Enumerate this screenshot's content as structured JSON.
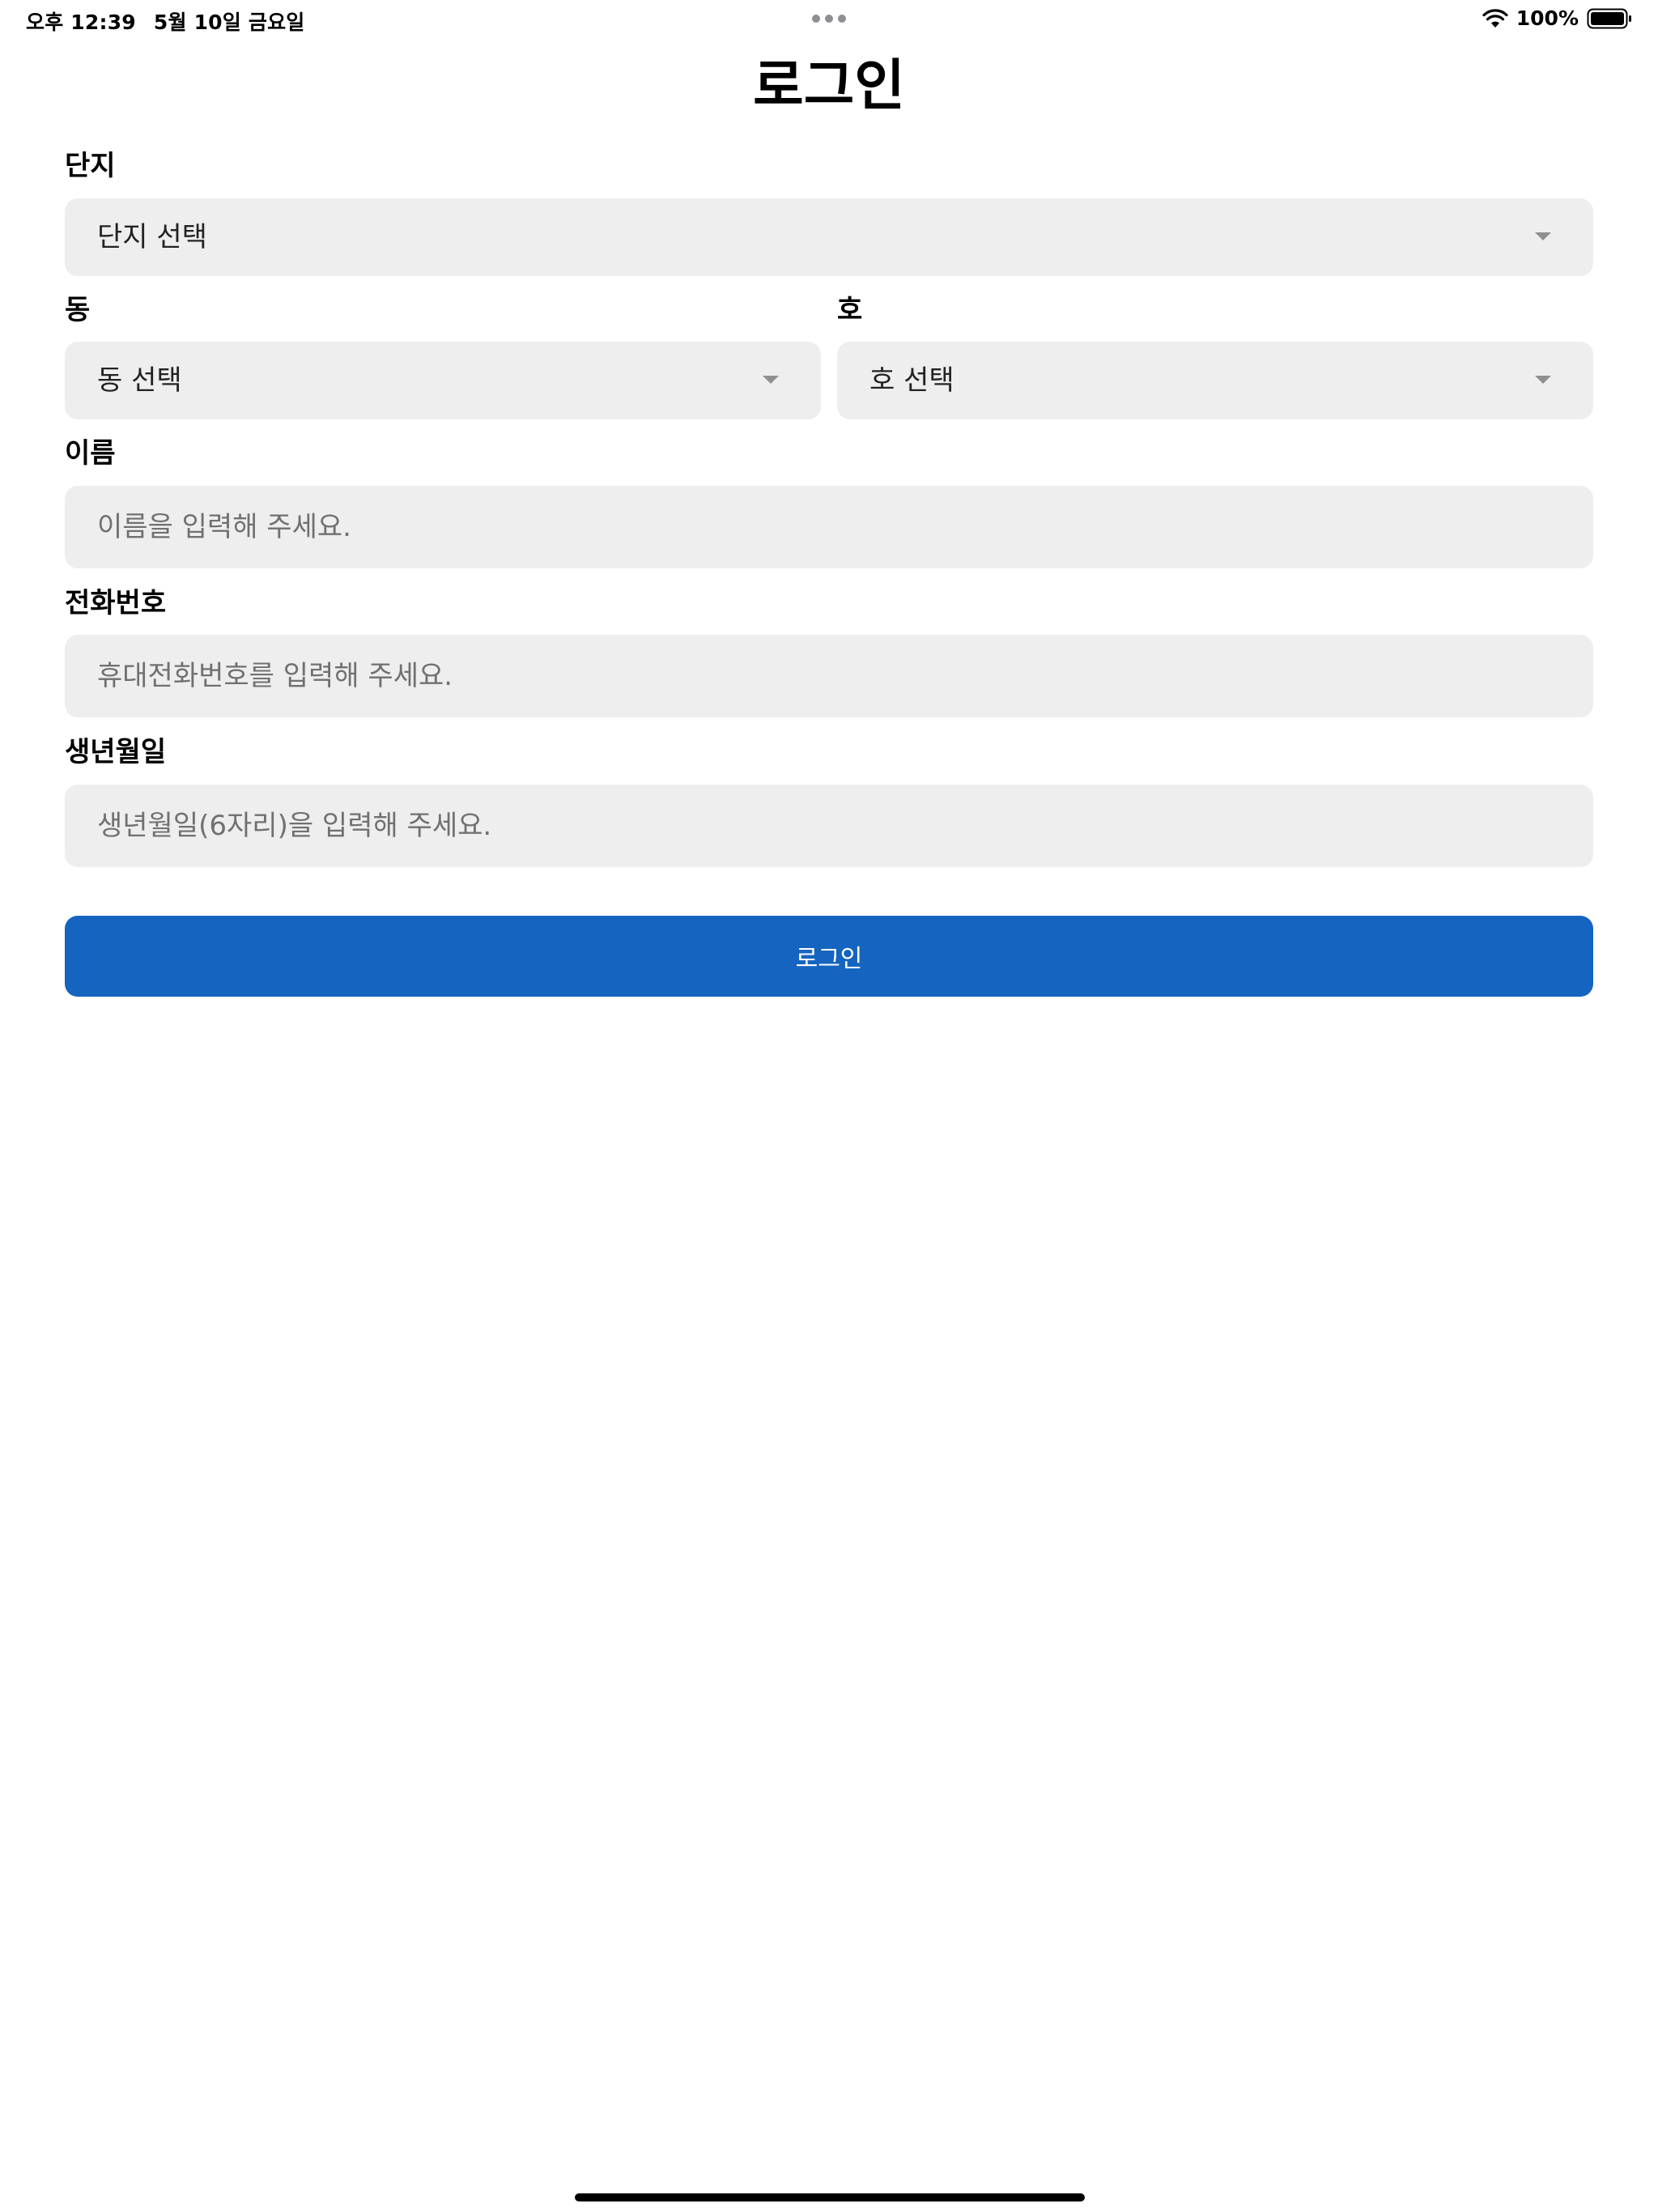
{
  "status_bar": {
    "time": "오후 12:39",
    "date": "5월 10일 금요일",
    "battery": "100%",
    "icons": [
      "wifi-icon",
      "battery-icon"
    ]
  },
  "title": "로그인",
  "form": {
    "complex": {
      "label": "단지",
      "value": "단지 선택"
    },
    "building": {
      "label": "동",
      "value": "동 선택"
    },
    "unit": {
      "label": "호",
      "value": "호 선택"
    },
    "name": {
      "label": "이름",
      "placeholder": "이름을 입력해 주세요."
    },
    "phone": {
      "label": "전화번호",
      "placeholder": "휴대전화번호를 입력해 주세요."
    },
    "birth": {
      "label": "생년월일",
      "placeholder": "생년월일(6자리)을 입력해 주세요."
    }
  },
  "login_button": "로그인",
  "colors": {
    "primary": "#1565c0",
    "field_bg": "#eeeeee"
  }
}
